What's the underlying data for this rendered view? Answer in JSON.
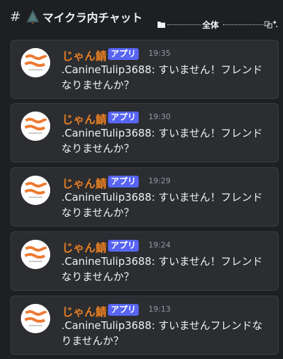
{
  "channel": {
    "hash": "#",
    "name": "マイクラ内チャット",
    "scope_label": "全体"
  },
  "messages": [
    {
      "username": "じゃん鯖",
      "badge": "アプリ",
      "time": "19:35",
      "text": ".CanineTulip3688: すいません！フレンドなりませんか？"
    },
    {
      "username": "じゃん鯖",
      "badge": "アプリ",
      "time": "19:30",
      "text": ".CanineTulip3688: すいません！フレンドなりませんか？"
    },
    {
      "username": "じゃん鯖",
      "badge": "アプリ",
      "time": "19:29",
      "text": ".CanineTulip3688: すいません！フレンドなりませんか？"
    },
    {
      "username": "じゃん鯖",
      "badge": "アプリ",
      "time": "19:24",
      "text": ".CanineTulip3688: すいません！フレンドなりませんか？"
    },
    {
      "username": "じゃん鯖",
      "badge": "アプリ",
      "time": "19:13",
      "text": ".CanineTulip3688: すいませんフレンドなりませんか？"
    }
  ],
  "colors": {
    "background": "#1e1f22",
    "card": "#2b2d31",
    "username": "#e67e22",
    "badge": "#5865f2",
    "timestamp": "#949ba4"
  },
  "icons": {
    "channel_emoji": "evergreen-tree-icon",
    "scope_start": "folder-icon",
    "scope_end": "plugin-sparkle-icon",
    "avatar": "server-logo-avatar"
  }
}
